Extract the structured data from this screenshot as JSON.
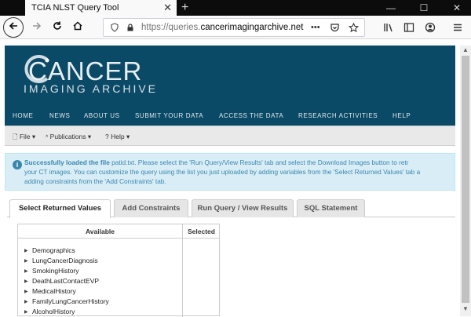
{
  "browser": {
    "tab_title": "TCIA NLST Query Tool",
    "tab_close": "✕",
    "new_tab": "+",
    "win_minimize": "—",
    "win_maximize": "☐",
    "win_close": "✕",
    "url_prefix": "https://queries.",
    "url_domain": "cancerimagingarchive.net",
    "page_actions": "•••"
  },
  "site": {
    "logo_main": "CANCER",
    "logo_sub": "IMAGING ARCHIVE",
    "nav": [
      "HOME",
      "NEWS",
      "ABOUT US",
      "SUBMIT YOUR DATA",
      "ACCESS THE DATA",
      "RESEARCH ACTIVITIES",
      "HELP"
    ],
    "menu": [
      "File ▾",
      "Publications ▾",
      "Help ▾"
    ]
  },
  "alert": {
    "strong": "Successfully loaded the file",
    "line1_rest": " patid.txt. Please select the 'Run Query/View Results' tab and select the Download Images button to retr",
    "line2": "your CT images. You can customize the query using the list you just uploaded by adding variables from the 'Select Returned Values' tab a",
    "line3": "adding constraints from the 'Add Constraints' tab."
  },
  "query_tabs": [
    "Select Returned Values",
    "Add Constraints",
    "Run Query / View Results",
    "SQL Statement"
  ],
  "panel": {
    "available_header": "Available",
    "selected_header": "Selected",
    "items": [
      "Demographics",
      "LungCancerDiagnosis",
      "SmokingHistory",
      "DeathLastContactEVP",
      "MedicalHistory",
      "FamilyLungCancerHistory",
      "AlcoholHistory"
    ]
  }
}
